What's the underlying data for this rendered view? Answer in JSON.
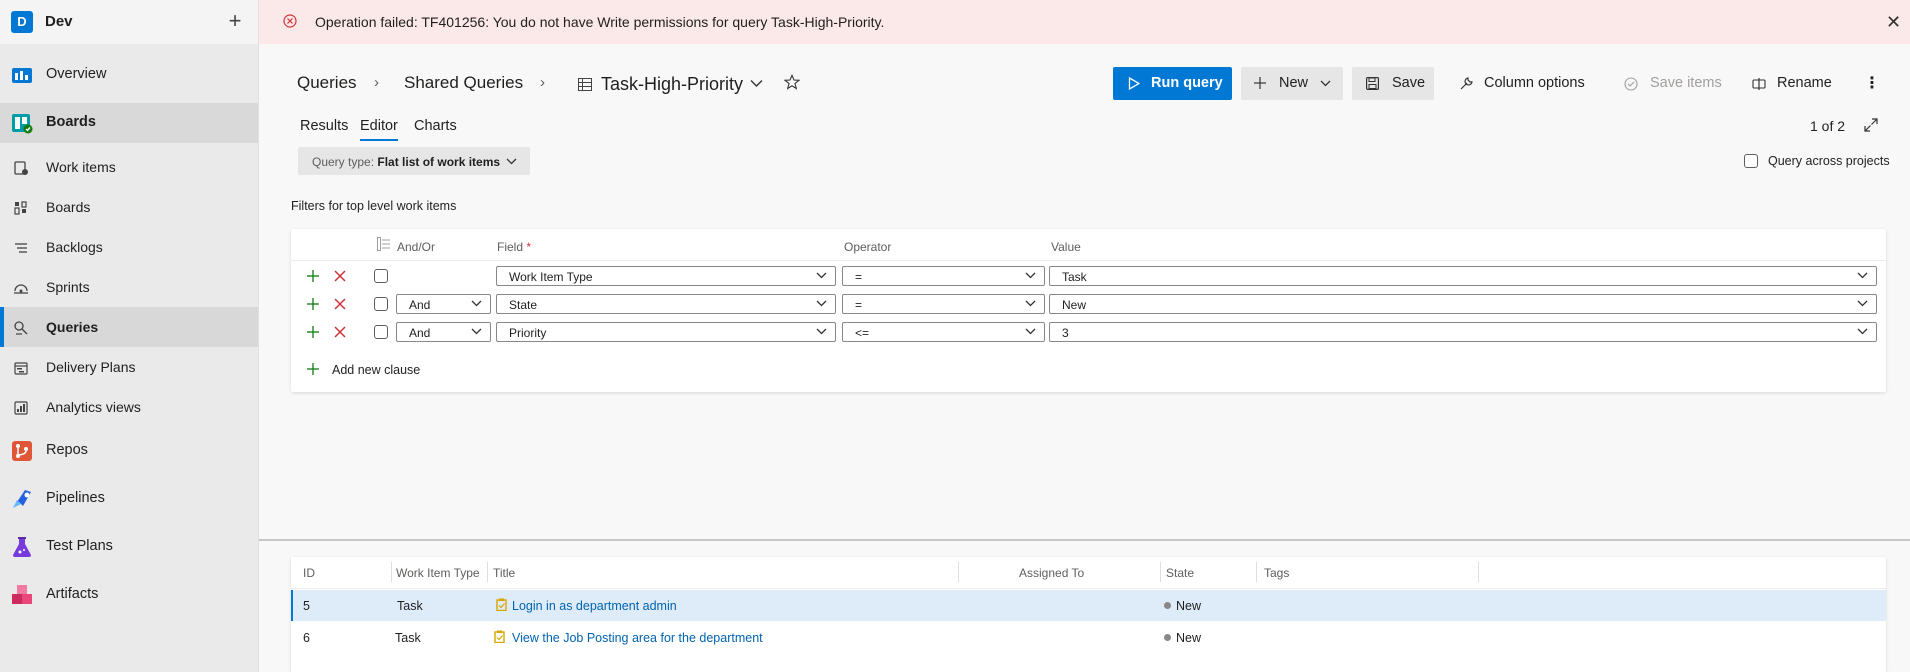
{
  "project": {
    "badge": "D",
    "name": "Dev",
    "add_label": "+"
  },
  "nav": {
    "overview": "Overview",
    "boards": "Boards",
    "work_items": "Work items",
    "boards_sub": "Boards",
    "backlogs": "Backlogs",
    "sprints": "Sprints",
    "queries": "Queries",
    "delivery_plans": "Delivery Plans",
    "analytics_views": "Analytics views",
    "repos": "Repos",
    "pipelines": "Pipelines",
    "test_plans": "Test Plans",
    "artifacts": "Artifacts"
  },
  "banner": {
    "message": "Operation failed: TF401256: You do not have Write permissions for query Task-High-Priority.",
    "close": "✕"
  },
  "breadcrumb": {
    "queries": "Queries",
    "shared": "Shared Queries",
    "query_name": "Task-High-Priority",
    "sep": "›"
  },
  "toolbar": {
    "run": "Run query",
    "new": "New",
    "save": "Save",
    "column_options": "Column options",
    "save_items": "Save items",
    "rename": "Rename",
    "more": "⋮"
  },
  "tabs": {
    "results": "Results",
    "editor": "Editor",
    "charts": "Charts"
  },
  "pager": "1 of 2",
  "query_type": {
    "label": "Query type:",
    "value": "Flat list of work items"
  },
  "query_across": "Query across projects",
  "filters": {
    "caption": "Filters for top level work items",
    "headers": {
      "andor": "And/Or",
      "field": "Field",
      "required": "*",
      "operator": "Operator",
      "value": "Value"
    },
    "rows": [
      {
        "andor": "",
        "field": "Work Item Type",
        "operator": "=",
        "value": "Task"
      },
      {
        "andor": "And",
        "field": "State",
        "operator": "=",
        "value": "New"
      },
      {
        "andor": "And",
        "field": "Priority",
        "operator": "<=",
        "value": "3"
      }
    ],
    "add_clause": "Add new clause"
  },
  "results": {
    "headers": {
      "id": "ID",
      "type": "Work Item Type",
      "title": "Title",
      "assigned": "Assigned To",
      "state": "State",
      "tags": "Tags"
    },
    "rows": [
      {
        "id": "5",
        "type": "Task",
        "title": "Login in as department admin",
        "assigned": "",
        "state": "New",
        "tags": ""
      },
      {
        "id": "6",
        "type": "Task",
        "title": "View the Job Posting area for the department",
        "assigned": "",
        "state": "New",
        "tags": ""
      }
    ]
  },
  "colors": {
    "accent": "#0078d4",
    "error_bg": "#fbe9e9",
    "error_icon": "#d13438",
    "task_icon": "#f2cb1d",
    "green_plus": "#107c10"
  }
}
